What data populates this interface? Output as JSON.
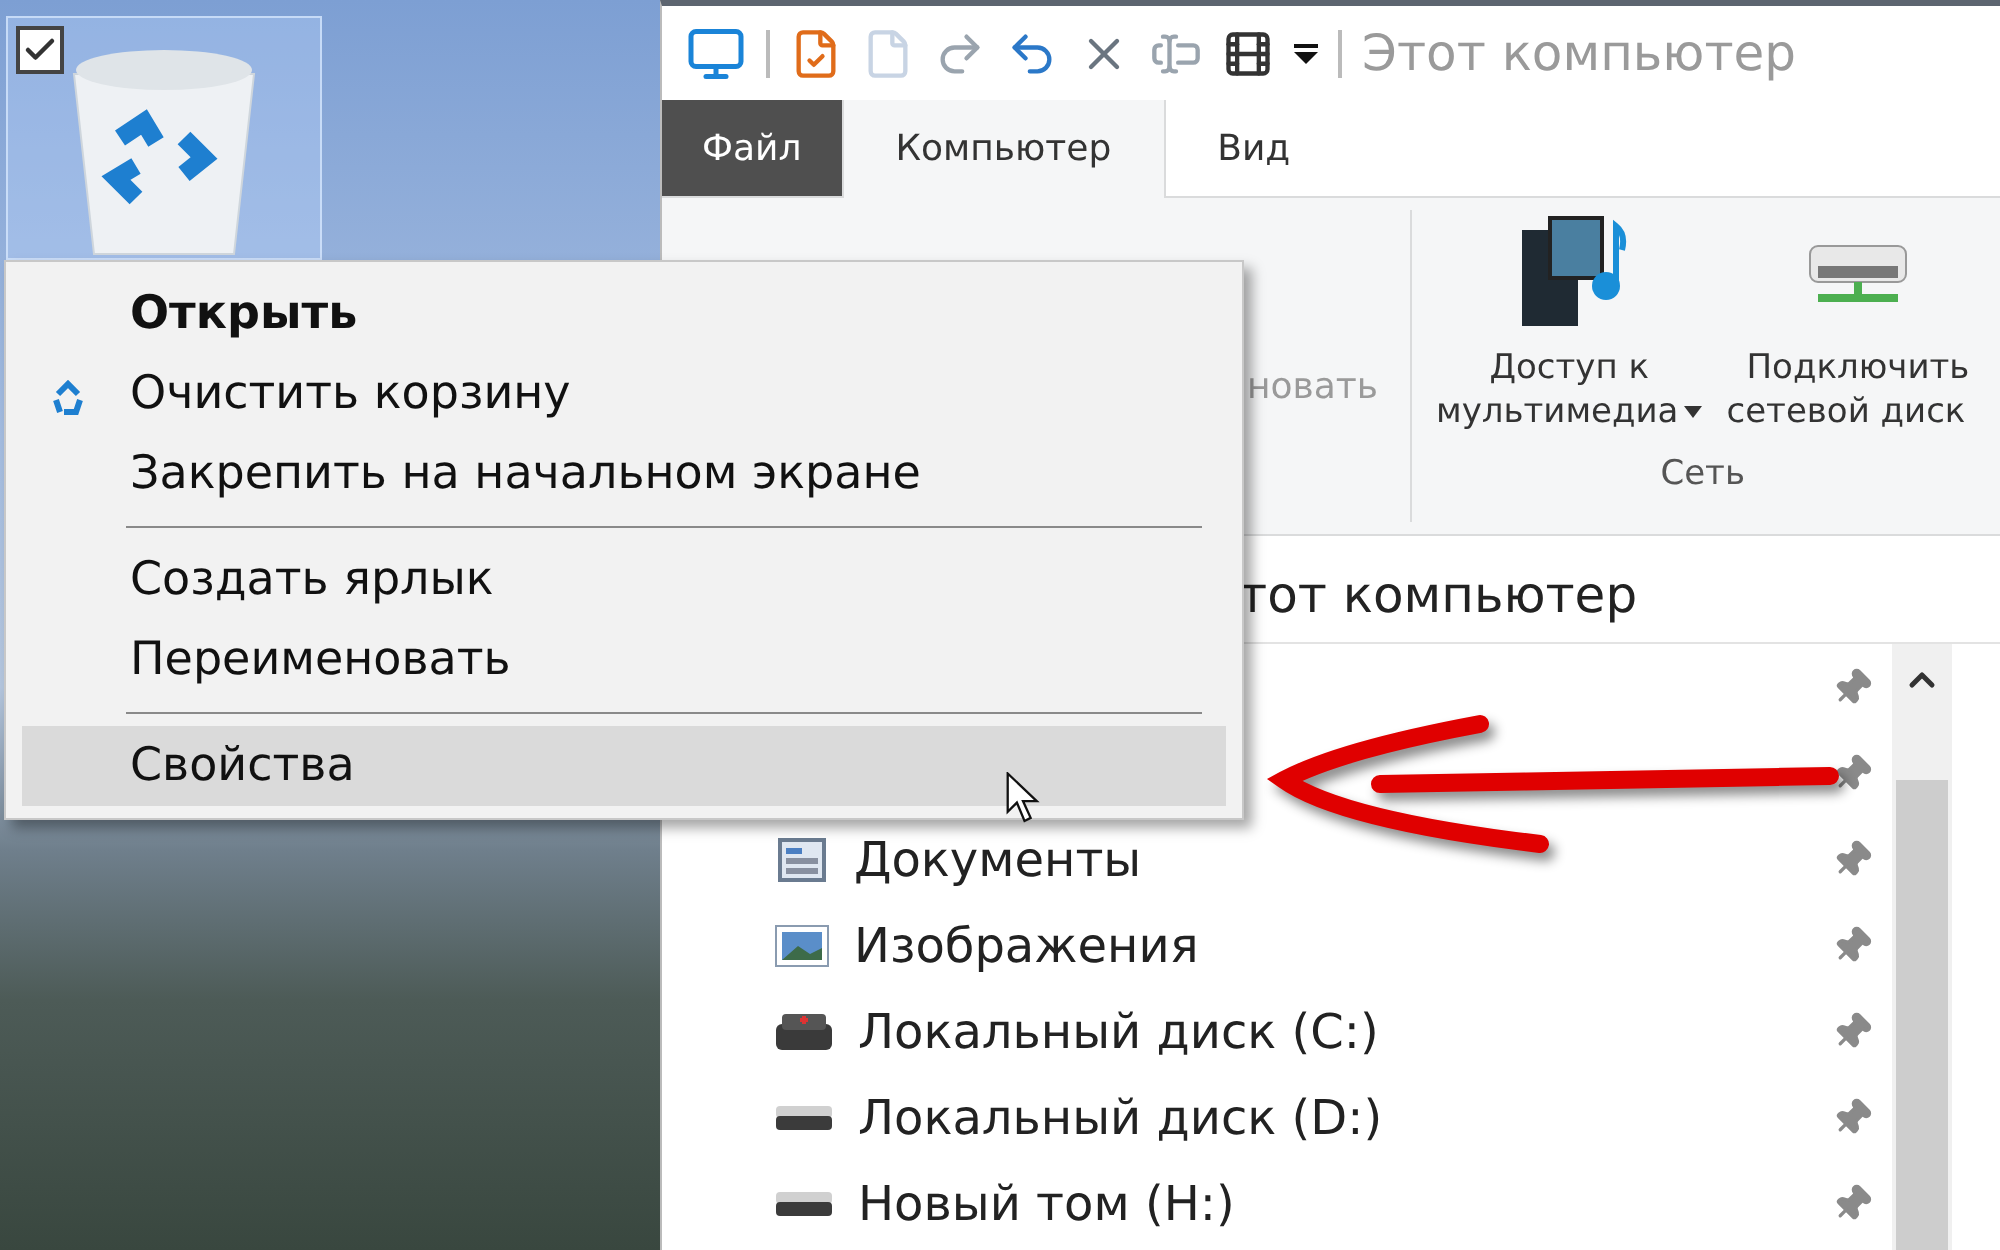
{
  "desktop": {
    "recycle_bin": {
      "checked": true,
      "selected": true
    }
  },
  "context_menu": {
    "items": [
      {
        "kind": "item",
        "label": "Открыть",
        "bold": true,
        "has_icon": false,
        "selected": false
      },
      {
        "kind": "item",
        "label": "Очистить корзину",
        "bold": false,
        "has_icon": true,
        "selected": false
      },
      {
        "kind": "item",
        "label": "Закрепить на начальном экране",
        "bold": false,
        "has_icon": false,
        "selected": false
      },
      {
        "kind": "separator"
      },
      {
        "kind": "item",
        "label": "Создать ярлык",
        "bold": false,
        "has_icon": false,
        "selected": false
      },
      {
        "kind": "item",
        "label": "Переименовать",
        "bold": false,
        "has_icon": false,
        "selected": false
      },
      {
        "kind": "separator"
      },
      {
        "kind": "item",
        "label": "Свойства",
        "bold": false,
        "has_icon": false,
        "selected": true
      }
    ]
  },
  "explorer": {
    "title": "Этот компьютер",
    "tabs": [
      {
        "kind": "file",
        "label": "Файл",
        "selected": false
      },
      {
        "kind": "tab",
        "label": "Компьютер",
        "selected": true
      },
      {
        "kind": "tab",
        "label": "Вид",
        "selected": false
      }
    ],
    "ribbon": {
      "partial_label": "новать",
      "groups": [
        {
          "label": "Сеть",
          "buttons": [
            {
              "kind": "media",
              "lines": [
                "Доступ к",
                "мультимедиа"
              ],
              "dropdown": true
            },
            {
              "kind": "network-drive",
              "lines": [
                "Подключить",
                "сетевой диск"
              ],
              "dropdown": false
            }
          ]
        }
      ]
    },
    "address": "тот компьютер",
    "nav_items": [
      {
        "pinned": true
      },
      {
        "pinned": true
      },
      {
        "kind": "documents",
        "label": "Документы",
        "pinned": true
      },
      {
        "kind": "pictures",
        "label": "Изображения",
        "pinned": true
      },
      {
        "kind": "system-drive",
        "label": "Локальный диск (C:)",
        "pinned": true
      },
      {
        "kind": "drive",
        "label": "Локальный диск (D:)",
        "pinned": true
      },
      {
        "kind": "drive",
        "label": "Новый том (H:)",
        "pinned": true
      }
    ]
  }
}
